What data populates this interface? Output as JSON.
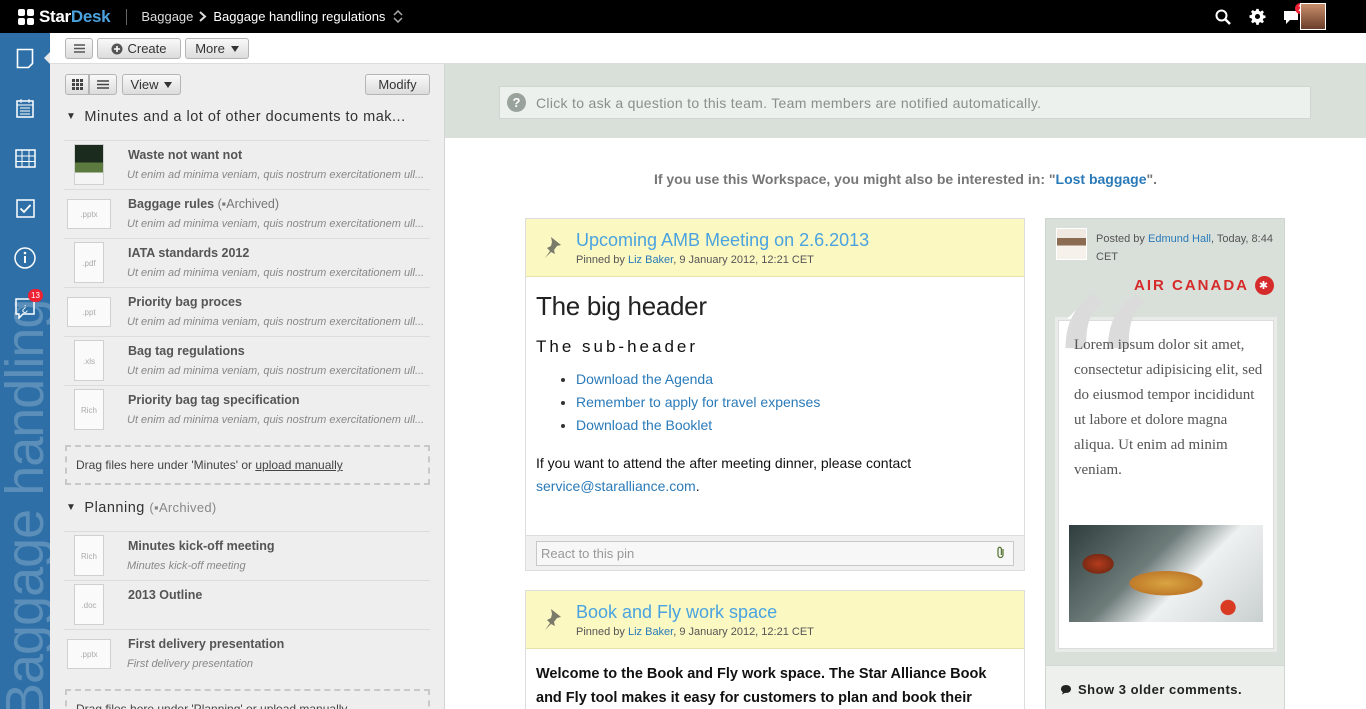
{
  "app": {
    "name_part1": "Star",
    "name_part2": "Desk"
  },
  "breadcrumb": {
    "parent": "Baggage",
    "current": "Baggage handling regulations"
  },
  "topbar": {
    "notifications_count": "2"
  },
  "rail": {
    "workspace_watermark": "Baggage handling",
    "help_badge": "13"
  },
  "toolbar": {
    "menu_label": "≡",
    "create_label": "Create",
    "more_label": "More"
  },
  "leftpanel": {
    "view_label": "View",
    "modify_label": "Modify",
    "sections": [
      {
        "title": "Minutes and a lot of other documents to mak...",
        "documents": [
          {
            "title": "Waste not want not",
            "archived": "",
            "subtitle": "Ut enim ad minima veniam, quis nostrum exercitationem ull...",
            "thumb": ""
          },
          {
            "title": "Baggage rules",
            "archived": "Archived",
            "subtitle": "Ut enim ad minima veniam, quis nostrum exercitationem ull...",
            "thumb": ".pptx"
          },
          {
            "title": "IATA standards 2012",
            "archived": "",
            "subtitle": "Ut enim ad minima veniam, quis nostrum exercitationem ull...",
            "thumb": ".pdf"
          },
          {
            "title": "Priority bag proces",
            "archived": "",
            "subtitle": "Ut enim ad minima veniam, quis nostrum exercitationem ull...",
            "thumb": ".ppt"
          },
          {
            "title": "Bag tag regulations",
            "archived": "",
            "subtitle": "Ut enim ad minima veniam, quis nostrum exercitationem ull...",
            "thumb": ".xls"
          },
          {
            "title": "Priority bag tag specification",
            "archived": "",
            "subtitle": "Ut enim ad minima veniam, quis nostrum exercitationem ull...",
            "thumb": "Rich"
          }
        ],
        "dropzone_text": "Drag files here under 'Minutes' or ",
        "dropzone_link": "upload manually"
      },
      {
        "title": "Planning",
        "archived": "Archived",
        "documents": [
          {
            "title": "Minutes kick-off meeting",
            "subtitle": "Minutes kick-off meeting",
            "thumb": "Rich"
          },
          {
            "title": "2013 Outline",
            "subtitle": "",
            "thumb": ".doc"
          },
          {
            "title": "First delivery presentation",
            "subtitle": "First delivery presentation",
            "thumb": ".pptx"
          }
        ],
        "dropzone_text": "Drag files here under 'Planning' or upload manually"
      }
    ]
  },
  "main": {
    "ask_placeholder": "Click to ask a question to this team. Team members are notified automatically.",
    "interest_prefix": "If you use this Workspace, you might also be interested in: \"",
    "interest_link": "Lost baggage",
    "interest_suffix": "\".",
    "pins": [
      {
        "title": "Upcoming AMB Meeting on 2.6.2013",
        "pinned_by_prefix": "Pinned by ",
        "pinned_by": "Liz Baker",
        "pinned_date": ", 9 January 2012, 12:21 CET",
        "big_header": "The big header",
        "sub_header": "The sub-header",
        "links": [
          "Download the Agenda",
          "Remember to apply for travel expenses",
          "Download the Booklet"
        ],
        "text": "If you want to attend the after meeting dinner, please contact",
        "email": "service@staralliance.com",
        "react_placeholder": "React to this pin"
      },
      {
        "title": "Book and Fly work space",
        "pinned_by_prefix": "Pinned by ",
        "pinned_by": "Liz Baker",
        "pinned_date": ", 9 January 2012, 12:21 CET",
        "body": "Welcome to the Book and Fly work space. The Star Alliance Book and Fly tool makes it easy for customers to plan and book their round the"
      }
    ],
    "post": {
      "posted_by_prefix": "Posted by ",
      "author": "Edmund Hall",
      "time": ", Today, 8:44 CET",
      "brand": "AIR CANADA",
      "quote": "Lorem ipsum dolor sit amet, consectetur adipisicing elit, sed do eiusmod tempor incididunt ut labore et dolore magna aliqua. Ut enim ad minim veniam.",
      "show_older": "Show 3 older comments."
    }
  },
  "colors": {
    "rail": "#2d6fa6",
    "accent": "#4aa3df",
    "link": "#2a7ab8",
    "pin_head": "#fbf8c2",
    "badge": "#e23"
  }
}
